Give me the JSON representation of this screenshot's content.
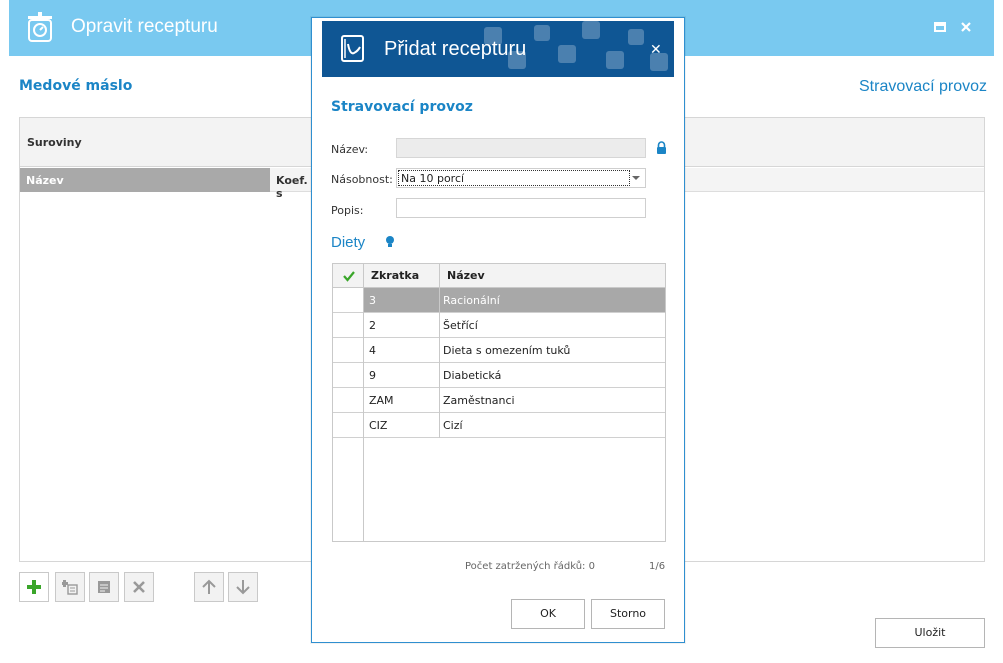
{
  "window": {
    "title": "Opravit recepturu",
    "icon": "scale-icon"
  },
  "recipe": {
    "name": "Medové máslo",
    "provoz_link": "Stravovací provoz"
  },
  "panel": {
    "title": "Suroviny",
    "columns": [
      "Název",
      "Koef. s"
    ]
  },
  "toolbar": {
    "save_label": "Uložit"
  },
  "dialog": {
    "title": "Přidat recepturu",
    "subtitle": "Stravovací provoz",
    "fields": {
      "nazev_label": "Název:",
      "nazev_value": "",
      "nasobnost_label": "Násobnost:",
      "nasobnost_value": "Na 10 porcí",
      "popis_label": "Popis:",
      "popis_value": ""
    },
    "diets_title": "Diety",
    "grid": {
      "columns": [
        "Zkratka",
        "Název"
      ],
      "rows": [
        {
          "code": "3",
          "name": "Racionální",
          "selected": true
        },
        {
          "code": "2",
          "name": "Šetřící",
          "selected": false
        },
        {
          "code": "4",
          "name": "Dieta s omezením tuků",
          "selected": false
        },
        {
          "code": "9",
          "name": "Diabetická",
          "selected": false
        },
        {
          "code": "ZAM",
          "name": "Zaměstnanci",
          "selected": false
        },
        {
          "code": "CIZ",
          "name": "Cizí",
          "selected": false
        }
      ]
    },
    "count_label": "Počet zatržených řádků: 0",
    "pager": "1/6",
    "ok_label": "OK",
    "cancel_label": "Storno"
  },
  "colors": {
    "accent": "#1b85c6",
    "titlebar": "#79c9f0",
    "dialog_header": "#0f5694",
    "selected_row": "#a8a8a8"
  }
}
